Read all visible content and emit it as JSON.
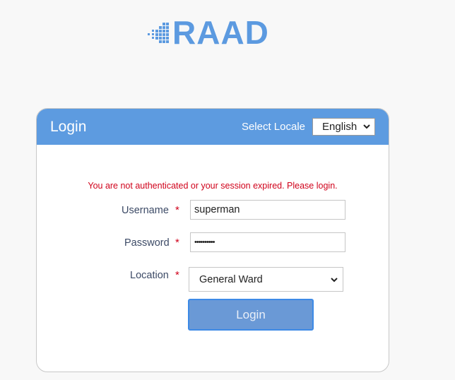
{
  "logo": {
    "text": "RAAD",
    "color": "#5c9ae0",
    "icon": "pixel-dots-icon"
  },
  "card": {
    "title": "Login",
    "locale": {
      "label": "Select Locale",
      "selected": "English"
    },
    "error_message": "You are not authenticated or your session expired. Please login.",
    "fields": {
      "username": {
        "label": "Username",
        "required_mark": "*",
        "value": "superman"
      },
      "password": {
        "label": "Password",
        "required_mark": "*",
        "value": "••••••••••"
      },
      "location": {
        "label": "Location",
        "required_mark": "*",
        "selected": "General Ward"
      }
    },
    "submit_label": "Login"
  },
  "colors": {
    "header": "#5d9be0",
    "error": "#d0021b",
    "button": "#6a99d6"
  }
}
